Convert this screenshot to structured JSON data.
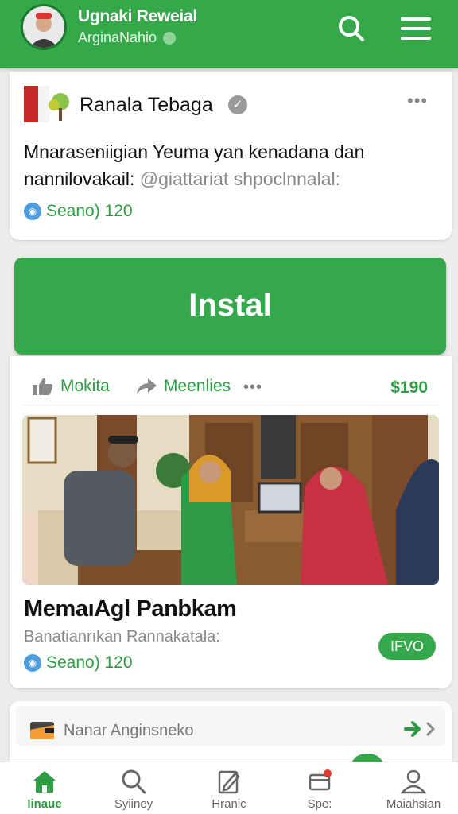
{
  "header": {
    "title": "Ugnaki Reweial",
    "subtitle": "ArginaNahio",
    "brand_color": "#35a84a",
    "icons": [
      "avatar-logo",
      "search-icon",
      "hamburger-menu-icon"
    ]
  },
  "post": {
    "author": "Ranala Tebaga",
    "verified_icon": "verified-badge-icon",
    "more_icon": "more-dots-icon",
    "text": "Mnaraseniigian Yeuma yan kenadana dan nannilovakail:",
    "mention": "@giattariat shpoclnnalal:",
    "stat": "Seano) 120"
  },
  "install_button": {
    "label": "Instal"
  },
  "feed_item": {
    "like_label": "Mokita",
    "share_label": "Meenlies",
    "price": "$190",
    "headline": "MemaıAgl Panbkam",
    "subline": "Banatianrıkan Rannakatala:",
    "stat": "Seano) 120",
    "chip": "IFVO"
  },
  "list_row": {
    "label": "Nanar Anginsneko",
    "icon": "wallet-icon",
    "action_icon": "arrow-right-icon"
  },
  "tabs": [
    {
      "label": "Iinaue",
      "icon": "home-icon",
      "active": true
    },
    {
      "label": "Syiiney",
      "icon": "search-icon",
      "active": false
    },
    {
      "label": "Hranic",
      "icon": "document-edit-icon",
      "active": false
    },
    {
      "label": "Spe:",
      "icon": "notification-icon",
      "active": false
    },
    {
      "label": "Maiahsian",
      "icon": "user-icon",
      "active": false
    }
  ],
  "colors": {
    "accent": "#35a84a",
    "link_green": "#2e9c42",
    "stat_blue": "#4a9ee0",
    "background": "#ececec"
  }
}
